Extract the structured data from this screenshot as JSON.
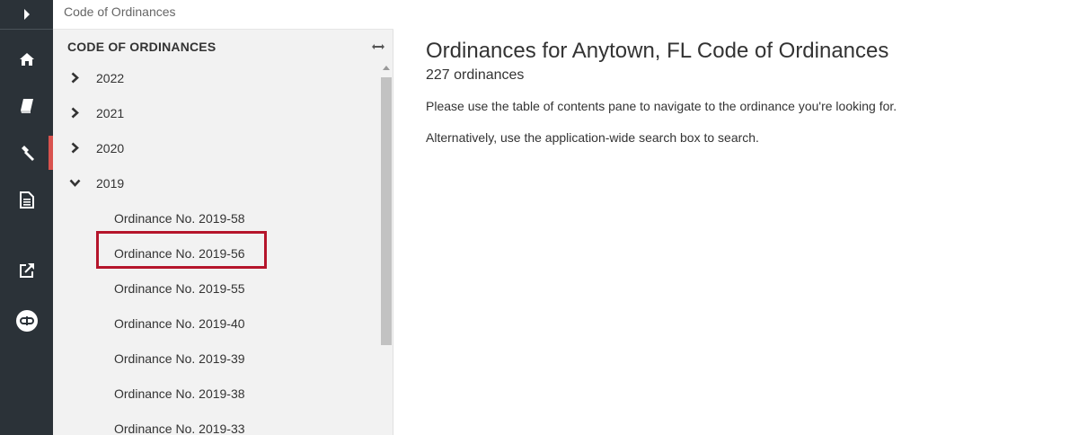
{
  "rail": {
    "icons": [
      "chevron-right-icon",
      "home-icon",
      "book-icon",
      "gavel-icon",
      "document-icon",
      "external-link-icon",
      "link-icon"
    ],
    "active_index": 3,
    "accent_color": "#d9534f"
  },
  "breadcrumb": {
    "label": "Code of Ordinances"
  },
  "toc": {
    "header": "CODE OF ORDINANCES",
    "collapse_icon": "left-right-arrow-icon",
    "years": [
      {
        "label": "2022",
        "expanded": false
      },
      {
        "label": "2021",
        "expanded": false
      },
      {
        "label": "2020",
        "expanded": false
      },
      {
        "label": "2019",
        "expanded": true
      }
    ],
    "children": [
      "Ordinance No. 2019-58",
      "Ordinance No. 2019-56",
      "Ordinance No. 2019-55",
      "Ordinance No. 2019-40",
      "Ordinance No. 2019-39",
      "Ordinance No. 2019-38",
      "Ordinance No. 2019-33"
    ],
    "highlighted_child": "Ordinance No. 2019-56",
    "highlight_color": "#b5152b"
  },
  "main": {
    "title": "Ordinances for Anytown, FL Code of Ordinances",
    "count": "227 ordinances",
    "instruction": "Please use the table of contents pane to navigate to the ordinance you're looking for.",
    "alternative": "Alternatively, use the application-wide search box to search."
  }
}
